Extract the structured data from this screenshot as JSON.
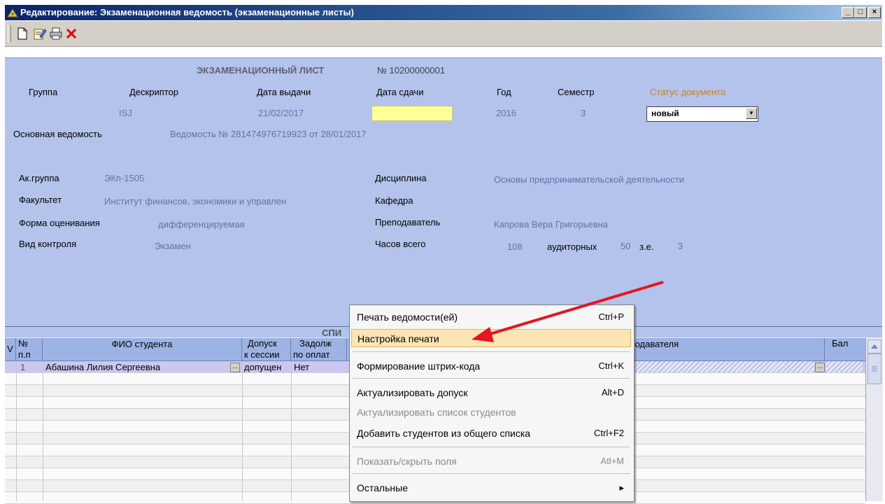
{
  "window": {
    "title": "Редактирование: Экзаменационная ведомость (экзаменационные листы)",
    "min_label": "_",
    "max_label": "□",
    "close_label": "×"
  },
  "toolbar": {
    "icons": [
      "new-document-icon",
      "edit-icon",
      "print-icon",
      "delete-icon"
    ]
  },
  "form": {
    "heading": "ЭКЗАМЕНАЦИОННЫЙ ЛИСТ",
    "number": "№ 10200000001",
    "labels": {
      "group": "Группа",
      "descriptor": "Дескриптор",
      "issue_date": "Дата выдачи",
      "submit_date": "Дата сдачи",
      "year": "Год",
      "semester": "Семестр",
      "status": "Статус документа",
      "main_sheet": "Основная ведомость",
      "ak_group": "Ак.группа",
      "faculty": "Факультет",
      "assessment_form": "Форма оценивания",
      "control_type": "Вид контроля",
      "discipline": "Дисциплина",
      "department": "Кафедра",
      "teacher": "Преподаватель",
      "hours_total": "Часов всего",
      "auditory": "аудиторных",
      "credits": "з.е."
    },
    "values": {
      "descriptor": "ISJ",
      "issue_date": "21/02/2017",
      "submit_date": "",
      "year": "2016",
      "semester": "3",
      "status": "новый",
      "main_sheet": "Ведомость № 281474976719923 от 28/01/2017",
      "ak_group": "ЭКп-1505",
      "faculty": "Институт финансов, экономики и управлен",
      "assessment_form": "дифференцируемая",
      "control_type": "Экзамен",
      "discipline": "Основы предпринимательской деятельности",
      "department": "",
      "teacher": "Капрова Вера Григорьевна",
      "hours_total": "108",
      "auditory": "50",
      "credits": "3"
    }
  },
  "grid": {
    "title": "СПИ",
    "headers": {
      "v": "V",
      "num_l1": "№",
      "num_l2": "п.п",
      "fio": "ФИО студента",
      "admit_l1": "Допуск",
      "admit_l2": "к сессии",
      "debt_l1": "Задолж",
      "debt_l2": "по оплат",
      "teacher": "ФИО преподавателя",
      "score": "Бал"
    },
    "rows": [
      {
        "num": "1",
        "fio": "Абашина Лилия Сергеевна",
        "admit": "допущен",
        "debt": "Нет"
      }
    ]
  },
  "context_menu": {
    "items": [
      {
        "label": "Печать ведомости(ей)",
        "shortcut": "Ctrl+P",
        "state": "normal"
      },
      {
        "label": "Настройка печати",
        "shortcut": "",
        "state": "highlighted"
      },
      {
        "label": "Формирование штрих-кода",
        "shortcut": "Ctrl+K",
        "state": "normal"
      },
      {
        "label": "Актуализировать допуск",
        "shortcut": "Alt+D",
        "state": "normal"
      },
      {
        "label": "Актуализировать список студентов",
        "shortcut": "",
        "state": "disabled"
      },
      {
        "label": "Добавить студентов из общего списка",
        "shortcut": "Ctrl+F2",
        "state": "normal"
      },
      {
        "label": "Показать/скрыть поля",
        "shortcut": "Atl+M",
        "state": "disabled"
      },
      {
        "label": "Остальные",
        "shortcut": "▸",
        "state": "normal"
      }
    ]
  },
  "colors": {
    "form_bg": "#b3c3eb",
    "menu_highlight": "#fbe5b5",
    "annotation_arrow": "#e8141e"
  }
}
